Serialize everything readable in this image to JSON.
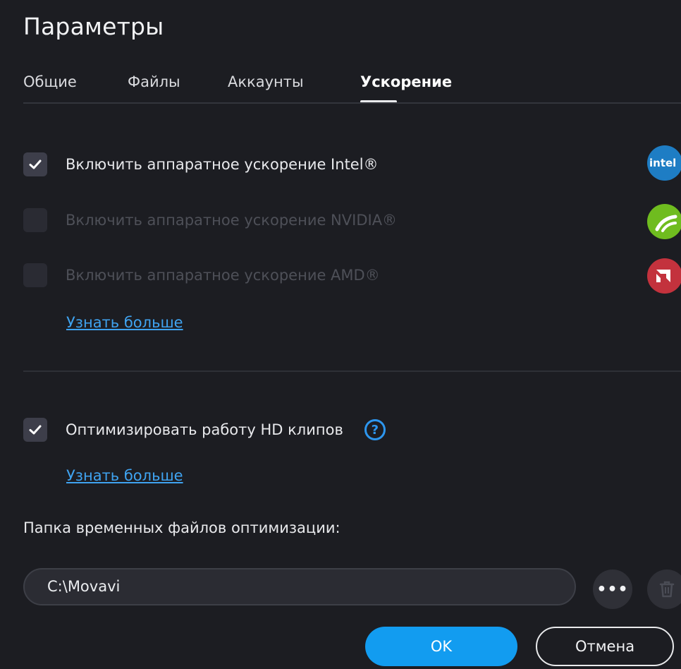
{
  "window": {
    "title": "Параметры"
  },
  "tabs": [
    {
      "label": "Общие"
    },
    {
      "label": "Файлы"
    },
    {
      "label": "Аккаунты"
    },
    {
      "label": "Ускорение",
      "active": true
    }
  ],
  "acceleration": {
    "intel": {
      "label": "Включить аппаратное ускорение Intel®",
      "checked": true,
      "enabled": true,
      "logo_text": "intel",
      "icon": "intel-logo-icon"
    },
    "nvidia": {
      "label": "Включить аппаратное ускорение NVIDIA®",
      "checked": false,
      "enabled": false,
      "icon": "nvidia-logo-icon"
    },
    "amd": {
      "label": "Включить аппаратное ускорение AMD®",
      "checked": false,
      "enabled": false,
      "icon": "amd-logo-icon"
    },
    "learn_more": "Узнать больше"
  },
  "hd_optimization": {
    "label": "Оптимизировать работу HD клипов",
    "checked": true,
    "help": "?",
    "learn_more": "Узнать больше"
  },
  "temp_folder": {
    "label": "Папка временных файлов оптимизации:",
    "value": "C:\\Movavi",
    "browse": "•••"
  },
  "footer": {
    "ok": "OK",
    "cancel": "Отмена"
  },
  "colors": {
    "background": "#1c1d22",
    "accent": "#129cf0",
    "link": "#3fa3f0"
  }
}
